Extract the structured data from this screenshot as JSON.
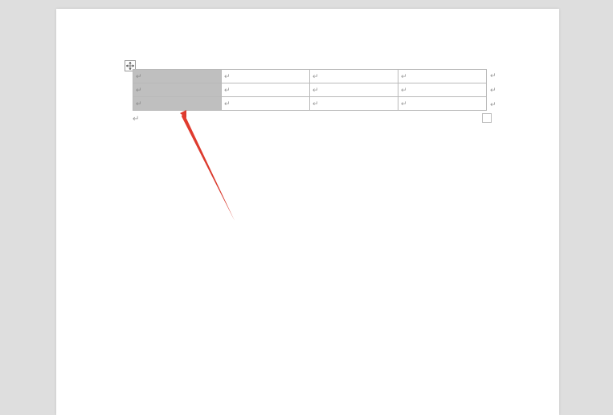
{
  "document": {
    "paragraph_mark": "↵",
    "row_end_mark": "↵",
    "cell_mark": "↵"
  },
  "table": {
    "rows": 3,
    "cols": 4,
    "selected_column_index": 0,
    "cells": [
      [
        "",
        "",
        "",
        ""
      ],
      [
        "",
        "",
        "",
        ""
      ],
      [
        "",
        "",
        "",
        ""
      ]
    ]
  },
  "annotation": {
    "type": "arrow",
    "color": "#e23b2e",
    "points_to": "selected-column"
  }
}
